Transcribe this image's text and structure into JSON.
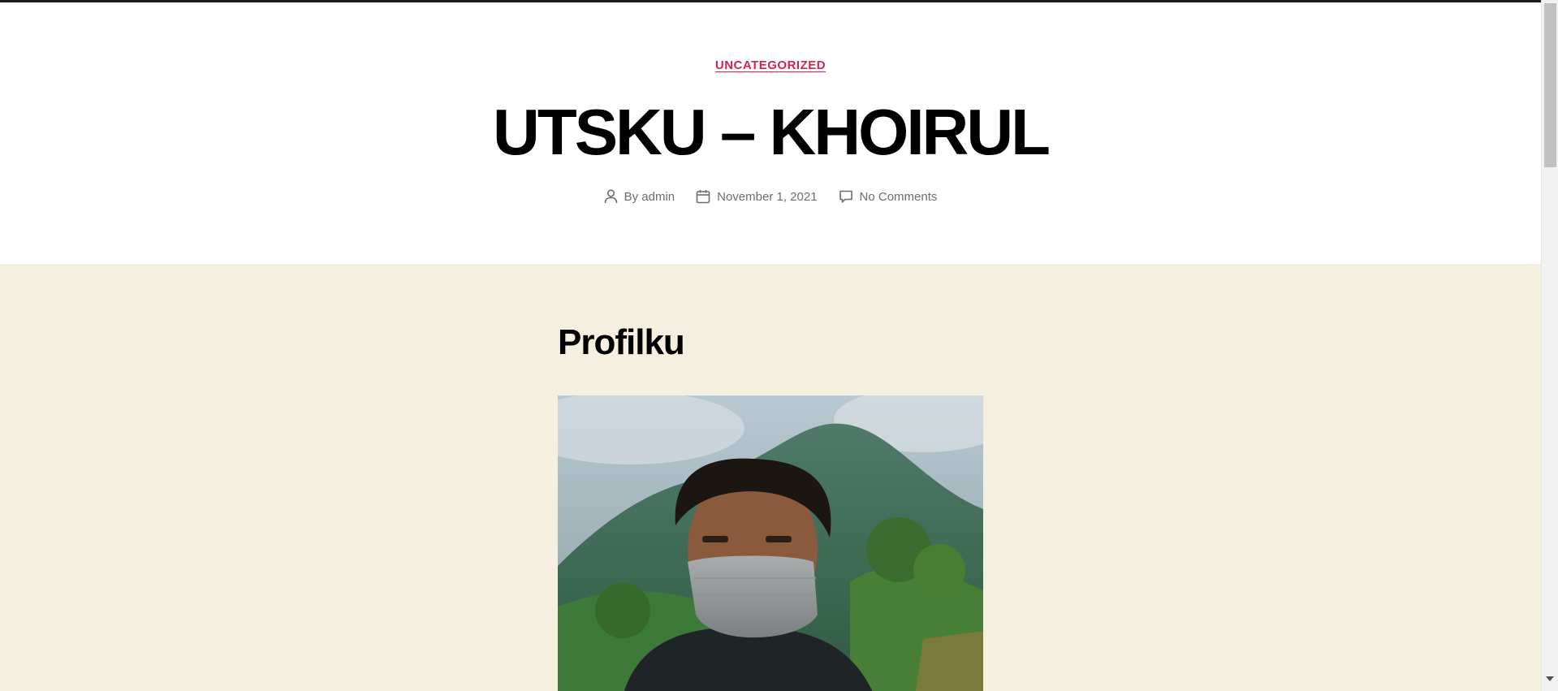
{
  "post": {
    "category": "UNCATEGORIZED",
    "title": "UTSKU – KHOIRUL",
    "meta": {
      "author": "By admin",
      "date": "November 1, 2021",
      "comments": "No Comments"
    }
  },
  "content": {
    "heading": "Profilku",
    "image_alt": "Portrait of a young man wearing a grey face mask in front of misty green hills"
  },
  "icons": {
    "author": "user-icon",
    "date": "calendar-icon",
    "comments": "comment-bubble-icon"
  },
  "colors": {
    "accent": "#cd2653",
    "content_background": "#f5efe0",
    "meta_text": "#6d6d6d",
    "title_text": "#000000"
  }
}
